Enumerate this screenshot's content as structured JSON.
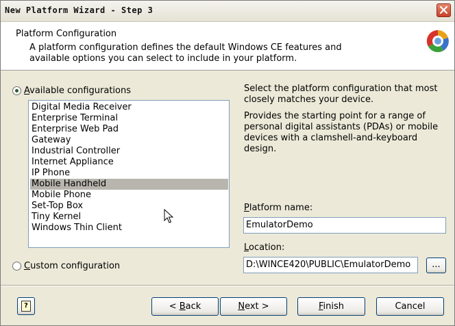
{
  "window": {
    "title": "New Platform Wizard - Step 3"
  },
  "header": {
    "title": "Platform Configuration",
    "description": "A platform configuration defines the default Windows CE features and available options you can select to include in your platform."
  },
  "available": {
    "label_first": "A",
    "label_rest": "vailable configurations",
    "selected": true,
    "items": [
      "Digital Media Receiver",
      "Enterprise Terminal",
      "Enterprise Web Pad",
      "Gateway",
      "Industrial Controller",
      "Internet Appliance",
      "IP Phone",
      "Mobile Handheld",
      "Mobile Phone",
      "Set-Top Box",
      "Tiny Kernel",
      "Windows Thin Client"
    ],
    "selected_item": "Mobile Handheld"
  },
  "custom": {
    "label_first": "C",
    "label_rest": "ustom configuration",
    "selected": false
  },
  "info": {
    "instruction": "Select the platform configuration that most closely matches your device.",
    "description": "Provides the starting point for a range of personal digital assistants (PDAs) or mobile devices with a clamshell-and-keyboard design."
  },
  "platform_name": {
    "label_first": "P",
    "label_rest": "latform name:",
    "value": "EmulatorDemo"
  },
  "location": {
    "label_first": "L",
    "label_rest": "ocation:",
    "value": "D:\\WINCE420\\PUBLIC\\EmulatorDemo",
    "browse_label": "..."
  },
  "buttons": {
    "back_prefix": "< ",
    "back_first": "B",
    "back_rest": "ack",
    "next_first": "N",
    "next_rest": "ext >",
    "finish_first": "F",
    "finish_rest": "inish",
    "cancel": "Cancel",
    "help_glyph": "?"
  },
  "icons": {
    "close": "close-icon",
    "logo": "windows-ce-logo-icon",
    "help": "help-icon",
    "cursor": "mouse-pointer-icon"
  },
  "colors": {
    "selection": "#b7b5ad",
    "close_button": "#c8412a",
    "border_accent": "#7f9db9"
  }
}
